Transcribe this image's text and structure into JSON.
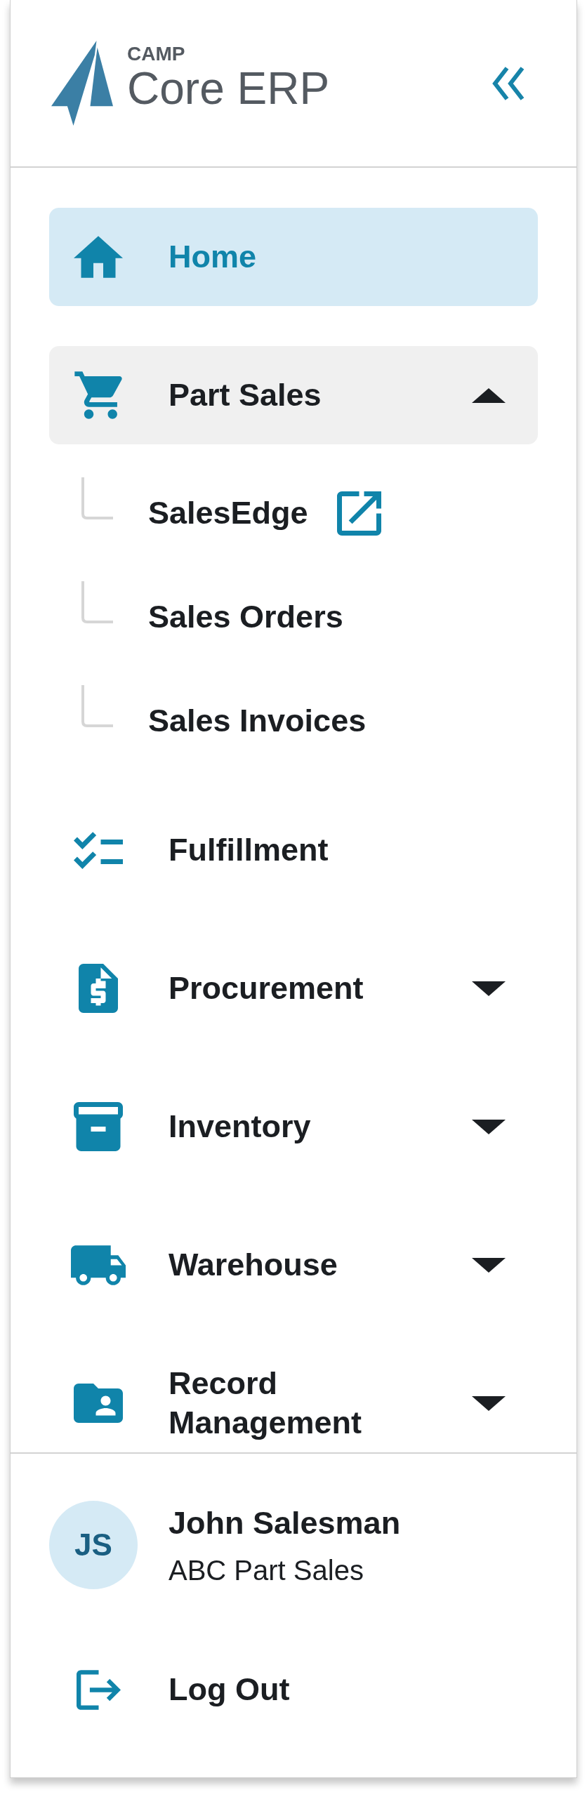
{
  "header": {
    "brand": "CAMP",
    "product": "Core ERP"
  },
  "nav": [
    {
      "label": "Home",
      "kind": "link",
      "selected": true
    },
    {
      "label": "Part Sales",
      "kind": "group",
      "selected": false,
      "expanded": true,
      "children": [
        {
          "label": "SalesEdge",
          "selected": false,
          "external": true
        },
        {
          "label": "Sales Orders",
          "selected": false,
          "external": false
        },
        {
          "label": "Sales Invoices",
          "selected": false,
          "external": false
        }
      ]
    },
    {
      "label": "Fulfillment",
      "kind": "link",
      "selected": false
    },
    {
      "label": "Procurement",
      "kind": "group",
      "selected": false,
      "expanded": false
    },
    {
      "label": "Inventory",
      "kind": "group",
      "selected": false,
      "expanded": false
    },
    {
      "label": "Warehouse",
      "kind": "group",
      "selected": false,
      "expanded": false
    },
    {
      "label": "Record Management",
      "kind": "group",
      "selected": false,
      "expanded": false
    }
  ],
  "user": {
    "initials": "JS",
    "name": "John Salesman",
    "company": "ABC Part Sales"
  },
  "logout": {
    "label": "Log Out"
  }
}
